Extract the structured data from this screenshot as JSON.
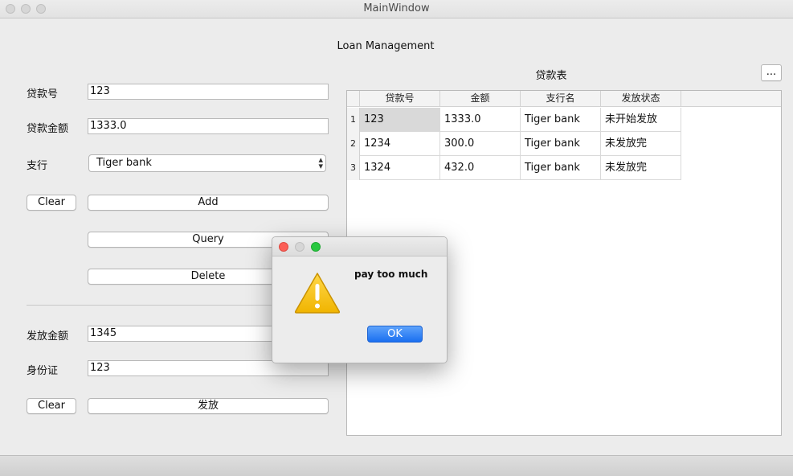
{
  "window": {
    "title": "MainWindow"
  },
  "app": {
    "heading": "Loan Management"
  },
  "form": {
    "loan_no_label": "贷款号",
    "loan_no_value": "123",
    "amount_label": "贷款金额",
    "amount_value": "1333.0",
    "branch_label": "支行",
    "branch_value": "Tiger bank",
    "clear_label": "Clear",
    "add_label": "Add",
    "query_label": "Query",
    "delete_label": "Delete"
  },
  "disburse": {
    "amount_label": "发放金额",
    "amount_value": "1345",
    "id_label": "身份证",
    "id_value": "123",
    "clear_label": "Clear",
    "submit_label": "发放"
  },
  "table": {
    "title": "贷款表",
    "more_label": "...",
    "columns": [
      "贷款号",
      "金额",
      "支行名",
      "发放状态"
    ],
    "rows": [
      {
        "index": "1",
        "cells": [
          "123",
          "1333.0",
          "Tiger bank",
          "未开始发放"
        ]
      },
      {
        "index": "2",
        "cells": [
          "1234",
          "300.0",
          "Tiger bank",
          "未发放完"
        ]
      },
      {
        "index": "3",
        "cells": [
          "1324",
          "432.0",
          "Tiger bank",
          "未发放完"
        ]
      }
    ]
  },
  "dialog": {
    "message": "pay too much",
    "ok_label": "OK",
    "icon": "warning-icon"
  },
  "colors": {
    "accent": "#1a6ff0",
    "close": "#fc5f57",
    "minimize": "#d6d6d6",
    "zoom": "#28c840",
    "warning": "#f5c518",
    "selected_cell": "#d9d9d9"
  }
}
